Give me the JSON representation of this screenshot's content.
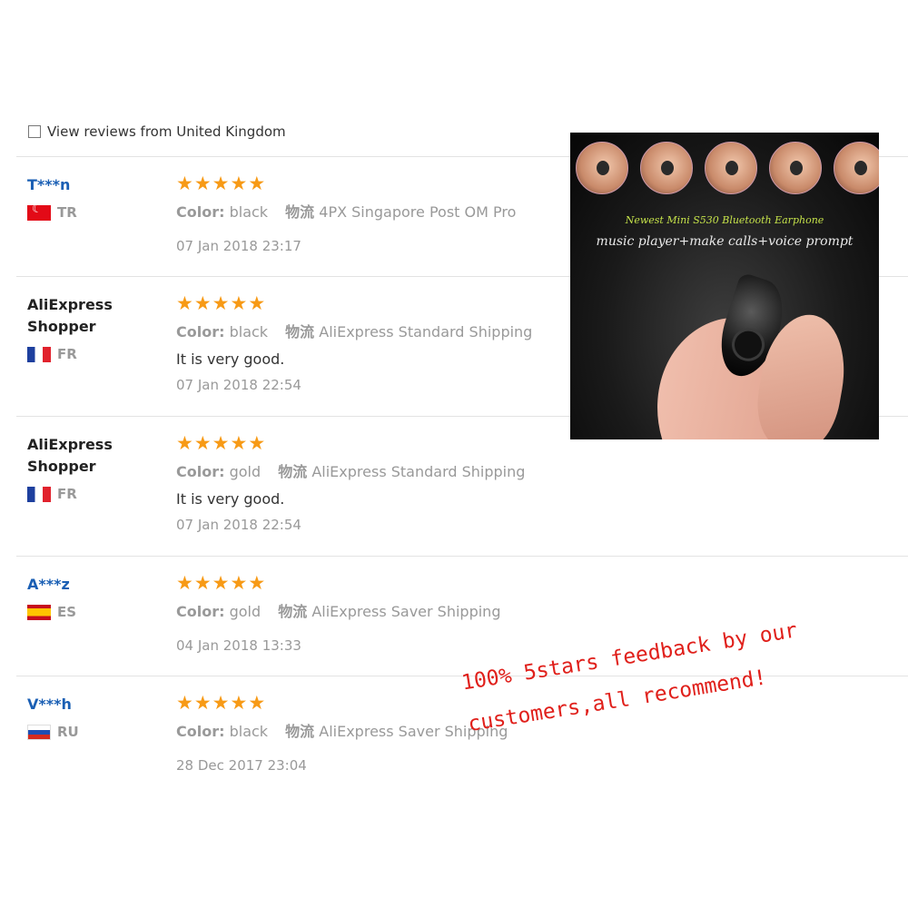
{
  "filter": {
    "label": "View reviews from United Kingdom",
    "checked": false
  },
  "reviews": [
    {
      "buyer": "T***n",
      "country_code": "TR",
      "rating": 5,
      "color_label": "Color:",
      "color": "black",
      "shipping_label": "物流",
      "shipping": "4PX Singapore Post OM Pro",
      "comment": "",
      "date": "07 Jan 2018 23:17"
    },
    {
      "buyer": "AliExpress Shopper",
      "country_code": "FR",
      "rating": 5,
      "color_label": "Color:",
      "color": "black",
      "shipping_label": "物流",
      "shipping": "AliExpress Standard Shipping",
      "comment": "It is very good.",
      "date": "07 Jan 2018 22:54"
    },
    {
      "buyer": "AliExpress Shopper",
      "country_code": "FR",
      "rating": 5,
      "color_label": "Color:",
      "color": "gold",
      "shipping_label": "物流",
      "shipping": "AliExpress Standard Shipping",
      "comment": "It is very good.",
      "date": "07 Jan 2018 22:54"
    },
    {
      "buyer": "A***z",
      "country_code": "ES",
      "rating": 5,
      "color_label": "Color:",
      "color": "gold",
      "shipping_label": "物流",
      "shipping": "AliExpress Saver Shipping",
      "comment": "",
      "date": "04 Jan 2018 13:33"
    },
    {
      "buyer": "V***h",
      "country_code": "RU",
      "rating": 5,
      "color_label": "Color:",
      "color": "black",
      "shipping_label": "物流",
      "shipping": "AliExpress Saver Shipping",
      "comment": "",
      "date": "28 Dec 2017 23:04"
    }
  ],
  "star_glyph": "★",
  "star_color": "#f79a16",
  "product_image": {
    "title": "Newest Mini S530 Bluetooth Earphone",
    "subtitle": "music player+make calls+voice prompt"
  },
  "promo": {
    "line1": "100% 5stars feedback by our",
    "line2": "customers,all recommend!",
    "color": "#e0201b"
  }
}
